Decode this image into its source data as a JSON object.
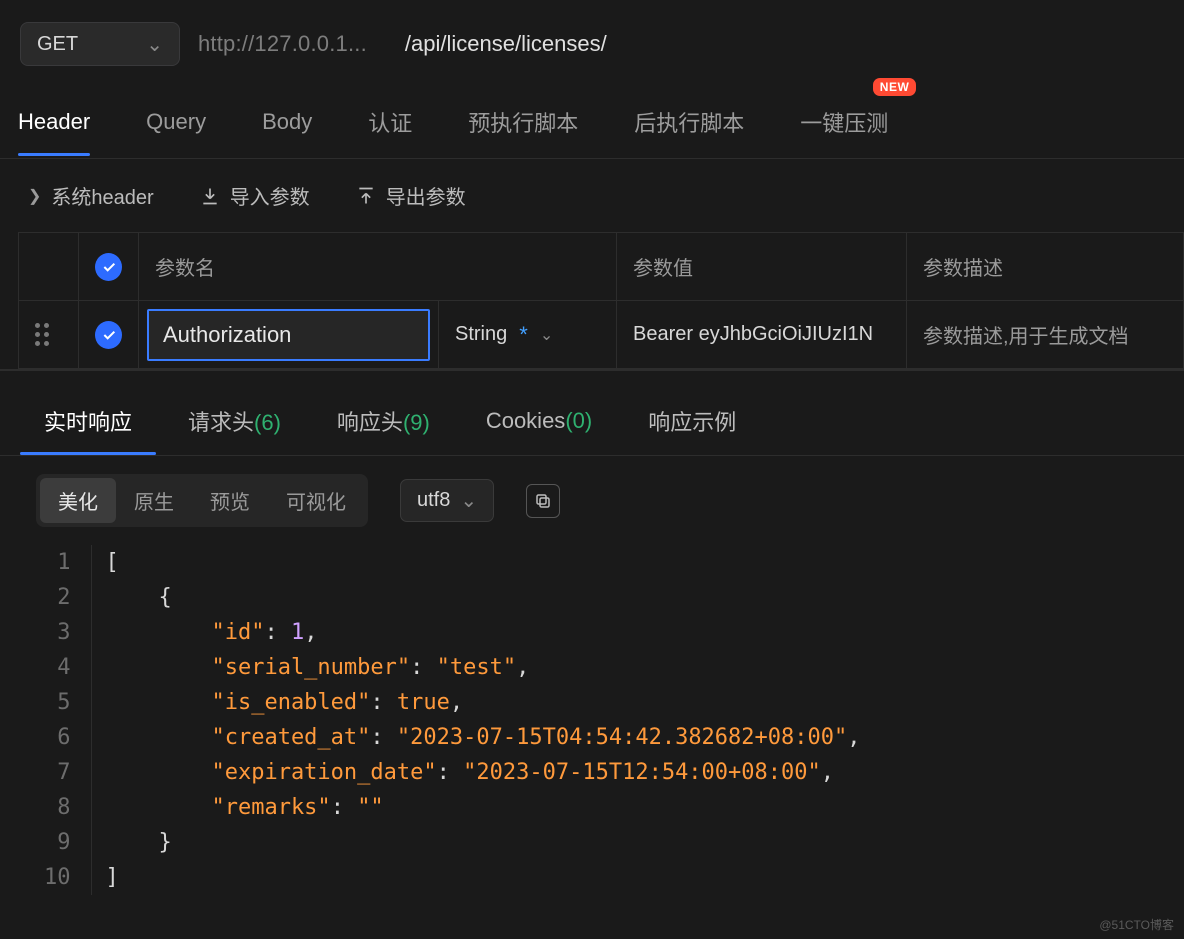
{
  "request": {
    "method": "GET",
    "host": "http://127.0.0.1...",
    "path": "/api/license/licenses/"
  },
  "mainTabs": {
    "items": [
      "Header",
      "Query",
      "Body",
      "认证",
      "预执行脚本",
      "后执行脚本",
      "一键压测"
    ],
    "activeIndex": 0,
    "badge": "NEW"
  },
  "toolbar": {
    "sysHeader": "系统header",
    "import": "导入参数",
    "export": "导出参数"
  },
  "paramsTable": {
    "headers": {
      "name": "参数名",
      "value": "参数值",
      "desc": "参数描述"
    },
    "typeLabel": "String",
    "row": {
      "name": "Authorization",
      "value": "Bearer eyJhbGciOiJIUzI1N",
      "descPlaceholder": "参数描述,用于生成文档"
    }
  },
  "respTabs": {
    "t1": "实时响应",
    "t2": "请求头",
    "t2n": "(6)",
    "t3": "响应头",
    "t3n": "(9)",
    "t4": "Cookies",
    "t4n": "(0)",
    "t5": "响应示例"
  },
  "viewBar": {
    "pills": [
      "美化",
      "原生",
      "预览",
      "可视化"
    ],
    "activePill": 0,
    "encoding": "utf8"
  },
  "response": {
    "lines": 10,
    "json": [
      {
        "id": 1,
        "serial_number": "test",
        "is_enabled": true,
        "created_at": "2023-07-15T04:54:42.382682+08:00",
        "expiration_date": "2023-07-15T12:54:00+08:00",
        "remarks": ""
      }
    ]
  },
  "watermark": "@51CTO博客"
}
